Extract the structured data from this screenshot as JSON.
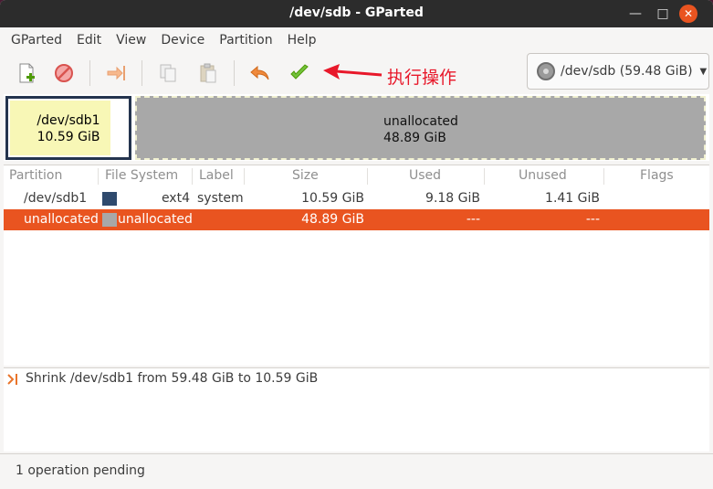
{
  "window": {
    "title": "/dev/sdb - GParted"
  },
  "menu": [
    "GParted",
    "Edit",
    "View",
    "Device",
    "Partition",
    "Help"
  ],
  "toolbar": {
    "icons": [
      "new-partition-icon",
      "delete-icon",
      "resize-move-icon",
      "copy-icon",
      "paste-icon",
      "undo-icon",
      "apply-icon"
    ],
    "annotation": "执行操作"
  },
  "device": {
    "label": "/dev/sdb (59.48 GiB)"
  },
  "diskmap": {
    "sdb1": {
      "name": "/dev/sdb1",
      "size": "10.59 GiB"
    },
    "unallocated": {
      "name": "unallocated",
      "size": "48.89 GiB"
    }
  },
  "table": {
    "headers": [
      "Partition",
      "File System",
      "Label",
      "Size",
      "Used",
      "Unused",
      "Flags"
    ],
    "rows": [
      {
        "partition": "/dev/sdb1",
        "fs": "ext4",
        "label": "system",
        "size": "10.59 GiB",
        "used": "9.18 GiB",
        "unused": "1.41 GiB",
        "flags": "",
        "color": "#2f4a6d"
      },
      {
        "partition": "unallocated",
        "fs": "unallocated",
        "label": "",
        "size": "48.89 GiB",
        "used": "---",
        "unused": "---",
        "flags": "",
        "color": "#a8a8a8"
      }
    ]
  },
  "operations": [
    "Shrink /dev/sdb1 from 59.48 GiB to 10.59 GiB"
  ],
  "status": "1 operation pending",
  "colors": {
    "accent": "#e95420",
    "titlebar": "#2c2c2c",
    "annotation": "#e8182a"
  }
}
